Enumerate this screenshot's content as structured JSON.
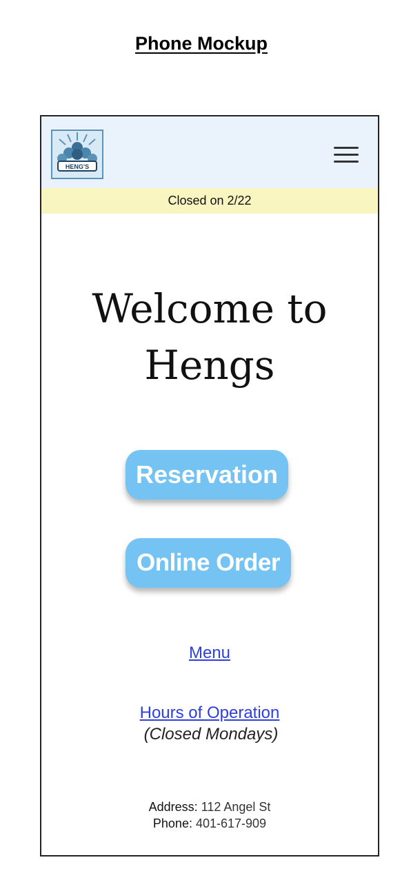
{
  "page": {
    "heading": "Phone Mockup"
  },
  "header": {
    "logo_text": "HENG'S",
    "colors": {
      "background": "#eaf3fb",
      "logo_border": "#5b93b7"
    }
  },
  "notice": {
    "text": "Closed on 2/22",
    "color": "#f8f5c0"
  },
  "hero": {
    "line1": "Welcome to",
    "line2": "Hengs"
  },
  "buttons": {
    "reservation": "Reservation",
    "online_order": "Online Order",
    "color": "#74c3f2"
  },
  "links": {
    "menu": "Menu",
    "hours": "Hours of Operation",
    "hours_note": "(Closed Mondays)",
    "color": "#2d3fdc"
  },
  "footer": {
    "address_label": "Address:",
    "address_value": "112 Angel St",
    "phone_label": "Phone:",
    "phone_value": "401-617-909"
  }
}
